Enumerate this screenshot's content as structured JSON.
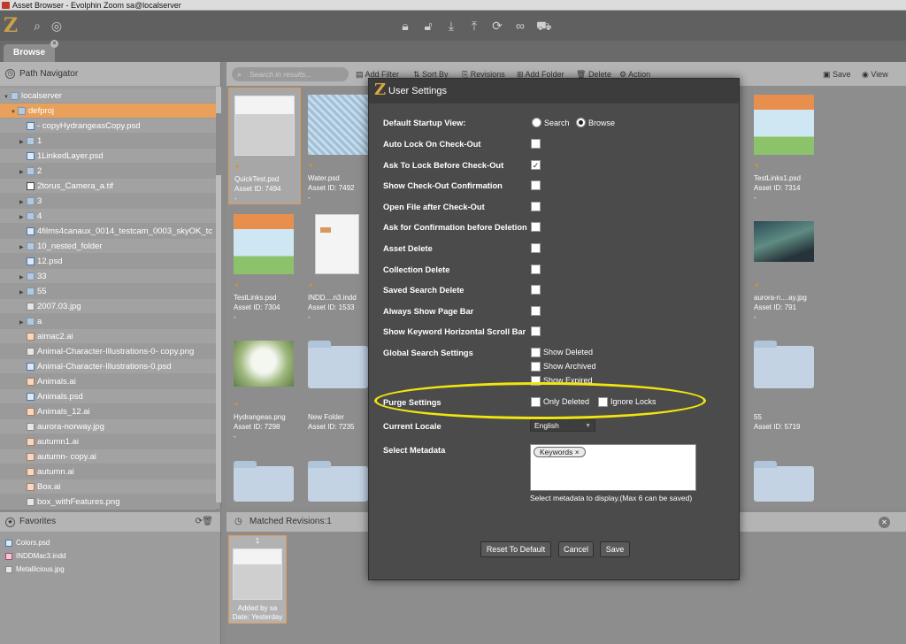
{
  "window": {
    "title": "Asset Browser - Evolphin Zoom sa@localserver"
  },
  "app": {
    "logo": "Z"
  },
  "tabs": [
    {
      "label": "Browse",
      "close": "×"
    }
  ],
  "path_navigator": {
    "title": "Path Navigator",
    "items": [
      {
        "label": "localserver",
        "type": "folder",
        "toggle": "▼"
      },
      {
        "label": "defproj",
        "type": "folder",
        "toggle": "▼"
      },
      {
        "label": "- copyHydrangeasCopy.psd",
        "type": "psd",
        "toggle": ""
      },
      {
        "label": "1",
        "type": "folder",
        "toggle": "▶"
      },
      {
        "label": "1LinkedLayer.psd",
        "type": "psd",
        "toggle": ""
      },
      {
        "label": "2",
        "type": "folder",
        "toggle": "▶"
      },
      {
        "label": "2torus_Camera_a.tif",
        "type": "tif",
        "toggle": ""
      },
      {
        "label": "3",
        "type": "folder",
        "toggle": "▶"
      },
      {
        "label": "4",
        "type": "folder",
        "toggle": "▶"
      },
      {
        "label": "4films4canaux_0014_testcam_0003_skyOK_tc",
        "type": "psd",
        "toggle": ""
      },
      {
        "label": "10_nested_folder",
        "type": "folder",
        "toggle": "▶"
      },
      {
        "label": "12.psd",
        "type": "psd",
        "toggle": ""
      },
      {
        "label": "33",
        "type": "folder",
        "toggle": "▶"
      },
      {
        "label": "55",
        "type": "folder",
        "toggle": "▶"
      },
      {
        "label": "2007.03.jpg",
        "type": "jpg",
        "toggle": ""
      },
      {
        "label": "a",
        "type": "folder",
        "toggle": "▶"
      },
      {
        "label": "aimac2.ai",
        "type": "ai",
        "toggle": ""
      },
      {
        "label": "Animal-Character-Illustrations-0- copy.png",
        "type": "jpg",
        "toggle": ""
      },
      {
        "label": "Animal-Character-Illustrations-0.psd",
        "type": "psd",
        "toggle": ""
      },
      {
        "label": "Animals.ai",
        "type": "ai",
        "toggle": ""
      },
      {
        "label": "Animals.psd",
        "type": "psd",
        "toggle": ""
      },
      {
        "label": "Animals_12.ai",
        "type": "ai",
        "toggle": ""
      },
      {
        "label": "aurora-norway.jpg",
        "type": "jpg",
        "toggle": ""
      },
      {
        "label": "autumn1.ai",
        "type": "ai",
        "toggle": ""
      },
      {
        "label": "autumn- copy.ai",
        "type": "ai",
        "toggle": ""
      },
      {
        "label": "autumn.ai",
        "type": "ai",
        "toggle": ""
      },
      {
        "label": "Box.ai",
        "type": "ai",
        "toggle": ""
      },
      {
        "label": "box_withFeatures.png",
        "type": "jpg",
        "toggle": ""
      }
    ]
  },
  "favorites": {
    "title": "Favorites",
    "items": [
      "Colors.psd",
      "INDDMac3.indd",
      "Metallicious.jpg"
    ]
  },
  "main_toolbar": {
    "search_placeholder": "Search in results...",
    "add_filter": "Add Filter",
    "sort_by": "Sort By",
    "revisions": "Revisions",
    "add_folder": "Add Folder",
    "delete": "Delete",
    "action": "Action",
    "save": "Save",
    "view": "View"
  },
  "assets": [
    {
      "name": "QuickTest.psd",
      "id": "Asset ID: 7494",
      "extra": "-",
      "kind": "image-gray"
    },
    {
      "name": "Water.psd",
      "id": "Asset ID: 7492",
      "extra": "-",
      "kind": "image-water"
    },
    {
      "name": "TestLinks1.psd",
      "id": "Asset ID: 7314",
      "extra": "-",
      "kind": "image-kids"
    },
    {
      "name": "TestLinks.psd",
      "id": "Asset ID: 7304",
      "extra": "-",
      "kind": "image-kids"
    },
    {
      "name": "INDD....n3.indd",
      "id": "Asset ID: 1533",
      "extra": "-",
      "kind": "image-doc"
    },
    {
      "name": "aurora-n....ay.jpg",
      "id": "Asset ID: 791",
      "extra": "-",
      "kind": "image-aurora"
    },
    {
      "name": "Hydrangeas.png",
      "id": "Asset ID: 7298",
      "extra": "-",
      "kind": "image-flower"
    },
    {
      "name": "New Folder",
      "id": "Asset ID: 7235",
      "extra": "",
      "kind": "folder"
    },
    {
      "name": "55",
      "id": "Asset ID: 5719",
      "extra": "",
      "kind": "folder"
    }
  ],
  "matched_revisions": {
    "title": "Matched Revisions:1",
    "card": {
      "number": "1",
      "added_by": "Added by sa",
      "date": "Date: Yesterday"
    }
  },
  "dialog": {
    "title": "User Settings",
    "default_view_label": "Default Startup View:",
    "view_options": [
      "Search",
      "Browse"
    ],
    "view_selected": "Browse",
    "settings": [
      {
        "label": "Auto Lock On Check-Out",
        "checked": false
      },
      {
        "label": "Ask To Lock Before Check-Out",
        "checked": true
      },
      {
        "label": "Show Check-Out Confirmation",
        "checked": false
      },
      {
        "label": "Open File after Check-Out",
        "checked": false
      },
      {
        "label": "Ask for Confirmation before Deletion",
        "checked": false
      },
      {
        "label": "Asset Delete",
        "checked": false
      },
      {
        "label": "Collection Delete",
        "checked": false
      },
      {
        "label": "Saved Search Delete",
        "checked": false
      },
      {
        "label": "Always Show Page Bar",
        "checked": false
      },
      {
        "label": "Show Keyword Horizontal Scroll Bar",
        "checked": false
      }
    ],
    "global_search_label": "Global Search Settings",
    "global_search_options": [
      {
        "label": "Show Deleted",
        "checked": false
      },
      {
        "label": "Show Archived",
        "checked": false
      },
      {
        "label": "Show Expired",
        "checked": false
      }
    ],
    "purge_label": "Purge Settings",
    "purge_options": [
      {
        "label": "Only Deleted",
        "checked": false
      },
      {
        "label": "Ignore Locks",
        "checked": false
      }
    ],
    "locale_label": "Current Locale",
    "locale_value": "English",
    "metadata_label": "Select Metadata",
    "metadata_chip": "Keywords",
    "metadata_chip_remove": "×",
    "metadata_hint": "Select metadata to display.(Max 6 can be saved)",
    "buttons": {
      "reset": "Reset To Default",
      "cancel": "Cancel",
      "save": "Save"
    }
  },
  "colors": {
    "accent": "#e8a05a",
    "highlight": "#f2e50f",
    "dialog_bg": "#4b4b4b"
  }
}
